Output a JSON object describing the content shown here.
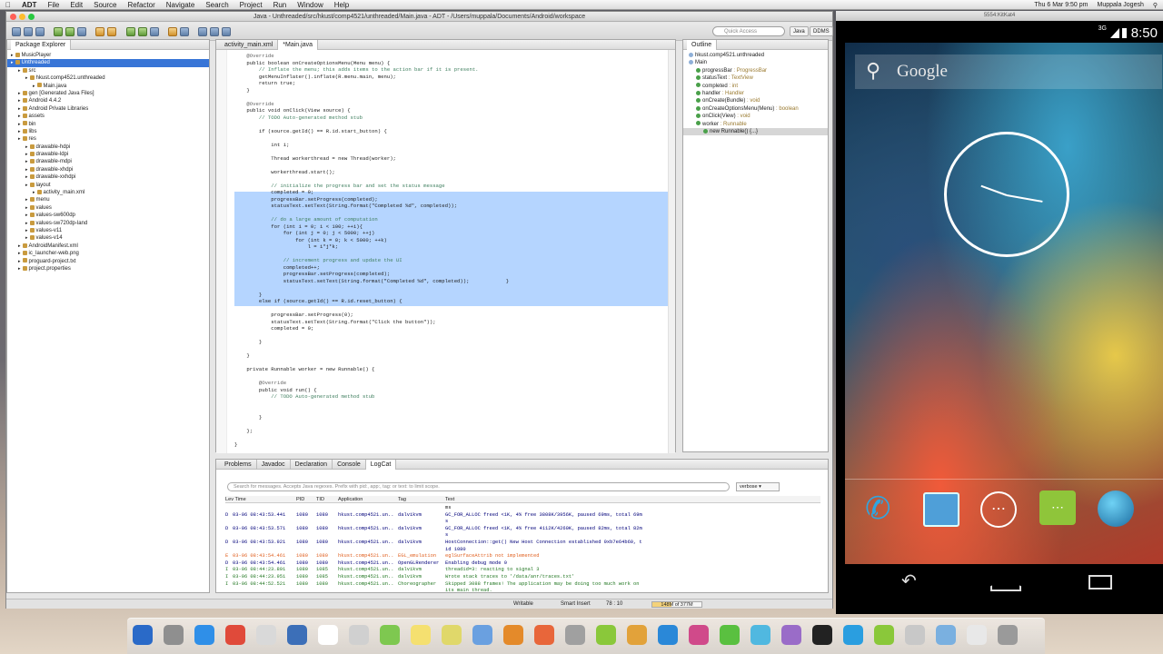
{
  "menubar": {
    "app": "ADT",
    "items": [
      "File",
      "Edit",
      "Source",
      "Refactor",
      "Navigate",
      "Search",
      "Project",
      "Run",
      "Window",
      "Help"
    ],
    "datetime": "Thu 6 Mar  9:50 pm",
    "user": "Muppala Jogesh"
  },
  "window": {
    "title": "Java - Unthreaded/src/hkust/comp4521/unthreaded/Main.java - ADT - /Users/muppala/Documents/Android/workspace"
  },
  "toolbar": {
    "quick_access_placeholder": "Quick Access",
    "perspectives": [
      "Java",
      "DDMS"
    ]
  },
  "package_explorer": {
    "title": "Package Explorer",
    "items": [
      {
        "label": "MusicPlayer",
        "indent": 0
      },
      {
        "label": "Unthreaded",
        "indent": 0,
        "selected": true
      },
      {
        "label": "src",
        "indent": 1
      },
      {
        "label": "hkust.comp4521.unthreaded",
        "indent": 2
      },
      {
        "label": "Main.java",
        "indent": 3
      },
      {
        "label": "gen [Generated Java Files]",
        "indent": 1
      },
      {
        "label": "Android 4.4.2",
        "indent": 1
      },
      {
        "label": "Android Private Libraries",
        "indent": 1
      },
      {
        "label": "assets",
        "indent": 1
      },
      {
        "label": "bin",
        "indent": 1
      },
      {
        "label": "libs",
        "indent": 1
      },
      {
        "label": "res",
        "indent": 1
      },
      {
        "label": "drawable-hdpi",
        "indent": 2
      },
      {
        "label": "drawable-ldpi",
        "indent": 2
      },
      {
        "label": "drawable-mdpi",
        "indent": 2
      },
      {
        "label": "drawable-xhdpi",
        "indent": 2
      },
      {
        "label": "drawable-xxhdpi",
        "indent": 2
      },
      {
        "label": "layout",
        "indent": 2
      },
      {
        "label": "activity_main.xml",
        "indent": 3
      },
      {
        "label": "menu",
        "indent": 2
      },
      {
        "label": "values",
        "indent": 2
      },
      {
        "label": "values-sw600dp",
        "indent": 2
      },
      {
        "label": "values-sw720dp-land",
        "indent": 2
      },
      {
        "label": "values-v11",
        "indent": 2
      },
      {
        "label": "values-v14",
        "indent": 2
      },
      {
        "label": "AndroidManifest.xml",
        "indent": 1
      },
      {
        "label": "ic_launcher-web.png",
        "indent": 1
      },
      {
        "label": "proguard-project.txt",
        "indent": 1
      },
      {
        "label": "project.properties",
        "indent": 1
      }
    ]
  },
  "editor": {
    "tabs": [
      "activity_main.xml",
      "*Main.java"
    ],
    "active_tab": 1,
    "lines": [
      {
        "text": "    @Override",
        "cls": "ann"
      },
      {
        "text": "    public boolean onCreateOptionsMenu(Menu menu) {",
        "cls": ""
      },
      {
        "text": "        // Inflate the menu; this adds items to the action bar if it is present.",
        "cls": "cm"
      },
      {
        "text": "        getMenuInflater().inflate(R.menu.main, menu);",
        "cls": ""
      },
      {
        "text": "        return true;",
        "cls": ""
      },
      {
        "text": "    }",
        "cls": ""
      },
      {
        "text": "",
        "cls": ""
      },
      {
        "text": "    @Override",
        "cls": "ann"
      },
      {
        "text": "    public void onClick(View source) {",
        "cls": ""
      },
      {
        "text": "        // TODO Auto-generated method stub",
        "cls": "cm"
      },
      {
        "text": "",
        "cls": ""
      },
      {
        "text": "        if (source.getId() == R.id.start_button) {",
        "cls": ""
      },
      {
        "text": "",
        "cls": ""
      },
      {
        "text": "            int i;",
        "cls": ""
      },
      {
        "text": "",
        "cls": ""
      },
      {
        "text": "            Thread workerthread = new Thread(worker);",
        "cls": ""
      },
      {
        "text": "",
        "cls": ""
      },
      {
        "text": "            workerthread.start();",
        "cls": ""
      },
      {
        "text": "",
        "cls": ""
      },
      {
        "text": "            // initialize the progress bar and set the status message",
        "cls": "cm"
      },
      {
        "text": "            completed = 0;",
        "cls": ""
      },
      {
        "text": "            progressBar.setProgress(completed);",
        "cls": ""
      },
      {
        "text": "            statusText.setText(String.format(\"Completed %d\", completed));",
        "cls": ""
      },
      {
        "text": "",
        "cls": ""
      },
      {
        "text": "            // do a large amount of computation",
        "cls": "cm"
      },
      {
        "text": "            for (int i = 0; i < 100; ++i){",
        "cls": ""
      },
      {
        "text": "                for (int j = 0; j < 5000; ++j)",
        "cls": ""
      },
      {
        "text": "                    for (int k = 0; k < 5000; ++k)",
        "cls": ""
      },
      {
        "text": "                        l = i*j*k;",
        "cls": ""
      },
      {
        "text": "",
        "cls": ""
      },
      {
        "text": "                // increment progress and update the UI",
        "cls": "cm"
      },
      {
        "text": "                completed++;",
        "cls": ""
      },
      {
        "text": "                progressBar.setProgress(completed);",
        "cls": ""
      },
      {
        "text": "                statusText.setText(String.format(\"Completed %d\", completed));            }",
        "cls": ""
      },
      {
        "text": "",
        "cls": ""
      },
      {
        "text": "        }",
        "cls": ""
      },
      {
        "text": "        else if (source.getId() == R.id.reset_button) {",
        "cls": ""
      },
      {
        "text": "",
        "cls": ""
      },
      {
        "text": "            progressBar.setProgress(0);",
        "cls": ""
      },
      {
        "text": "            statusText.setText(String.format(\"Click the button\"));",
        "cls": ""
      },
      {
        "text": "            completed = 0;",
        "cls": ""
      },
      {
        "text": "",
        "cls": ""
      },
      {
        "text": "        }",
        "cls": ""
      },
      {
        "text": "",
        "cls": ""
      },
      {
        "text": "    }",
        "cls": ""
      },
      {
        "text": "",
        "cls": ""
      },
      {
        "text": "    private Runnable worker = new Runnable() {",
        "cls": ""
      },
      {
        "text": "",
        "cls": ""
      },
      {
        "text": "        @Override",
        "cls": "ann"
      },
      {
        "text": "        public void run() {",
        "cls": ""
      },
      {
        "text": "            // TODO Auto-generated method stub",
        "cls": "cm"
      },
      {
        "text": "",
        "cls": ""
      },
      {
        "text": "",
        "cls": ""
      },
      {
        "text": "        }",
        "cls": ""
      },
      {
        "text": "",
        "cls": ""
      },
      {
        "text": "    };",
        "cls": ""
      },
      {
        "text": "",
        "cls": ""
      },
      {
        "text": "}",
        "cls": ""
      }
    ]
  },
  "outline": {
    "title": "Outline",
    "items": [
      {
        "name": "hkust.comp4521.unthreaded",
        "type": "",
        "indent": 0
      },
      {
        "name": "Main",
        "type": "",
        "indent": 0
      },
      {
        "name": "progressBar",
        "type": " : ProgressBar",
        "indent": 1
      },
      {
        "name": "statusText",
        "type": " : TextView",
        "indent": 1
      },
      {
        "name": "completed",
        "type": " : int",
        "indent": 1
      },
      {
        "name": "handler",
        "type": " : Handler",
        "indent": 1
      },
      {
        "name": "onCreate(Bundle)",
        "type": " : void",
        "indent": 1
      },
      {
        "name": "onCreateOptionsMenu(Menu)",
        "type": " : boolean",
        "indent": 1
      },
      {
        "name": "onClick(View)",
        "type": " : void",
        "indent": 1
      },
      {
        "name": "worker",
        "type": " : Runnable",
        "indent": 1
      },
      {
        "name": "new Runnable() {...}",
        "type": "",
        "indent": 2,
        "selected": true
      }
    ]
  },
  "bottom": {
    "tabs": [
      "Problems",
      "Javadoc",
      "Declaration",
      "Console",
      "LogCat"
    ],
    "active_tab": 4,
    "search_placeholder": "Search for messages. Accepts Java regexes. Prefix with pid:, app:, tag: or text: to limit scope.",
    "level": "verbose",
    "columns": [
      "Lev Time",
      "PID",
      "TID",
      "Application",
      "Tag",
      "Text"
    ],
    "rows": [
      {
        "lev": "",
        "time": "",
        "pid": "",
        "tid": "",
        "app": "",
        "tag": "",
        "text": "ms",
        "color": "#222"
      },
      {
        "lev": "D",
        "time": "03-06 08:43:53.441",
        "pid": "1080",
        "tid": "1080",
        "app": "hkust.comp4521.un..",
        "tag": "dalvikvm",
        "text": "GC_FOR_ALLOC freed <1K, 4% free 3808K/3956K, paused 69ms, total 69m",
        "color": "#00007a"
      },
      {
        "lev": "",
        "time": "",
        "pid": "",
        "tid": "",
        "app": "",
        "tag": "",
        "text": "s",
        "color": "#00007a"
      },
      {
        "lev": "D",
        "time": "03-06 08:43:53.571",
        "pid": "1080",
        "tid": "1080",
        "app": "hkust.comp4521.un..",
        "tag": "dalvikvm",
        "text": "GC_FOR_ALLOC freed <1K, 4% free 4112K/4260K, paused 82ms, total 82m",
        "color": "#00007a"
      },
      {
        "lev": "",
        "time": "",
        "pid": "",
        "tid": "",
        "app": "",
        "tag": "",
        "text": "s",
        "color": "#00007a"
      },
      {
        "lev": "D",
        "time": "03-06 08:43:53.921",
        "pid": "1080",
        "tid": "1080",
        "app": "hkust.comp4521.un..",
        "tag": "dalvikvm",
        "text": "HostConnection::get() New Host Connection established 0xb7e64b60, t",
        "color": "#00007a"
      },
      {
        "lev": "",
        "time": "",
        "pid": "",
        "tid": "",
        "app": "",
        "tag": "",
        "text": "id 1080",
        "color": "#00007a"
      },
      {
        "lev": "E",
        "time": "03-06 08:43:54.461",
        "pid": "1080",
        "tid": "1080",
        "app": "hkust.comp4521.un..",
        "tag": "EGL_emulation",
        "text": "eglSurfaceAttrib not implemented",
        "color": "#e06020"
      },
      {
        "lev": "D",
        "time": "03-06 08:43:54.461",
        "pid": "1080",
        "tid": "1080",
        "app": "hkust.comp4521.un..",
        "tag": "OpenGLRenderer",
        "text": "Enabling debug mode 0",
        "color": "#00007a"
      },
      {
        "lev": "I",
        "time": "03-06 08:44:23.891",
        "pid": "1080",
        "tid": "1085",
        "app": "hkust.comp4521.un..",
        "tag": "dalvikvm",
        "text": "threadid=3: reacting to signal 3",
        "color": "#227722"
      },
      {
        "lev": "I",
        "time": "03-06 08:44:23.951",
        "pid": "1080",
        "tid": "1085",
        "app": "hkust.comp4521.un..",
        "tag": "dalvikvm",
        "text": "Wrote stack traces to '/data/anr/traces.txt'",
        "color": "#227722"
      },
      {
        "lev": "I",
        "time": "03-06 08:44:52.521",
        "pid": "1080",
        "tid": "1080",
        "app": "hkust.comp4521.un..",
        "tag": "Choreographer",
        "text": "Skipped 3088 frames!  The application may be doing too much work on",
        "color": "#227722"
      },
      {
        "lev": "",
        "time": "",
        "pid": "",
        "tid": "",
        "app": "",
        "tag": "",
        "text": " its main thread.",
        "color": "#227722"
      }
    ]
  },
  "status": {
    "writable": "Writable",
    "insert": "Smart Insert",
    "position": "78 : 10",
    "heap": "148M of 377M",
    "heap_fraction": 0.39
  },
  "emulator": {
    "title": "5554:KitKat4",
    "network": "3G",
    "time": "8:50",
    "search_label": "Google",
    "clock_hour_hand_deg": 200,
    "clock_minute_hand_deg": 190
  },
  "colors": {
    "selection": "#b5d5ff",
    "keyword": "#7f0055",
    "comment": "#3f7f5f",
    "string": "#2a00ff"
  }
}
